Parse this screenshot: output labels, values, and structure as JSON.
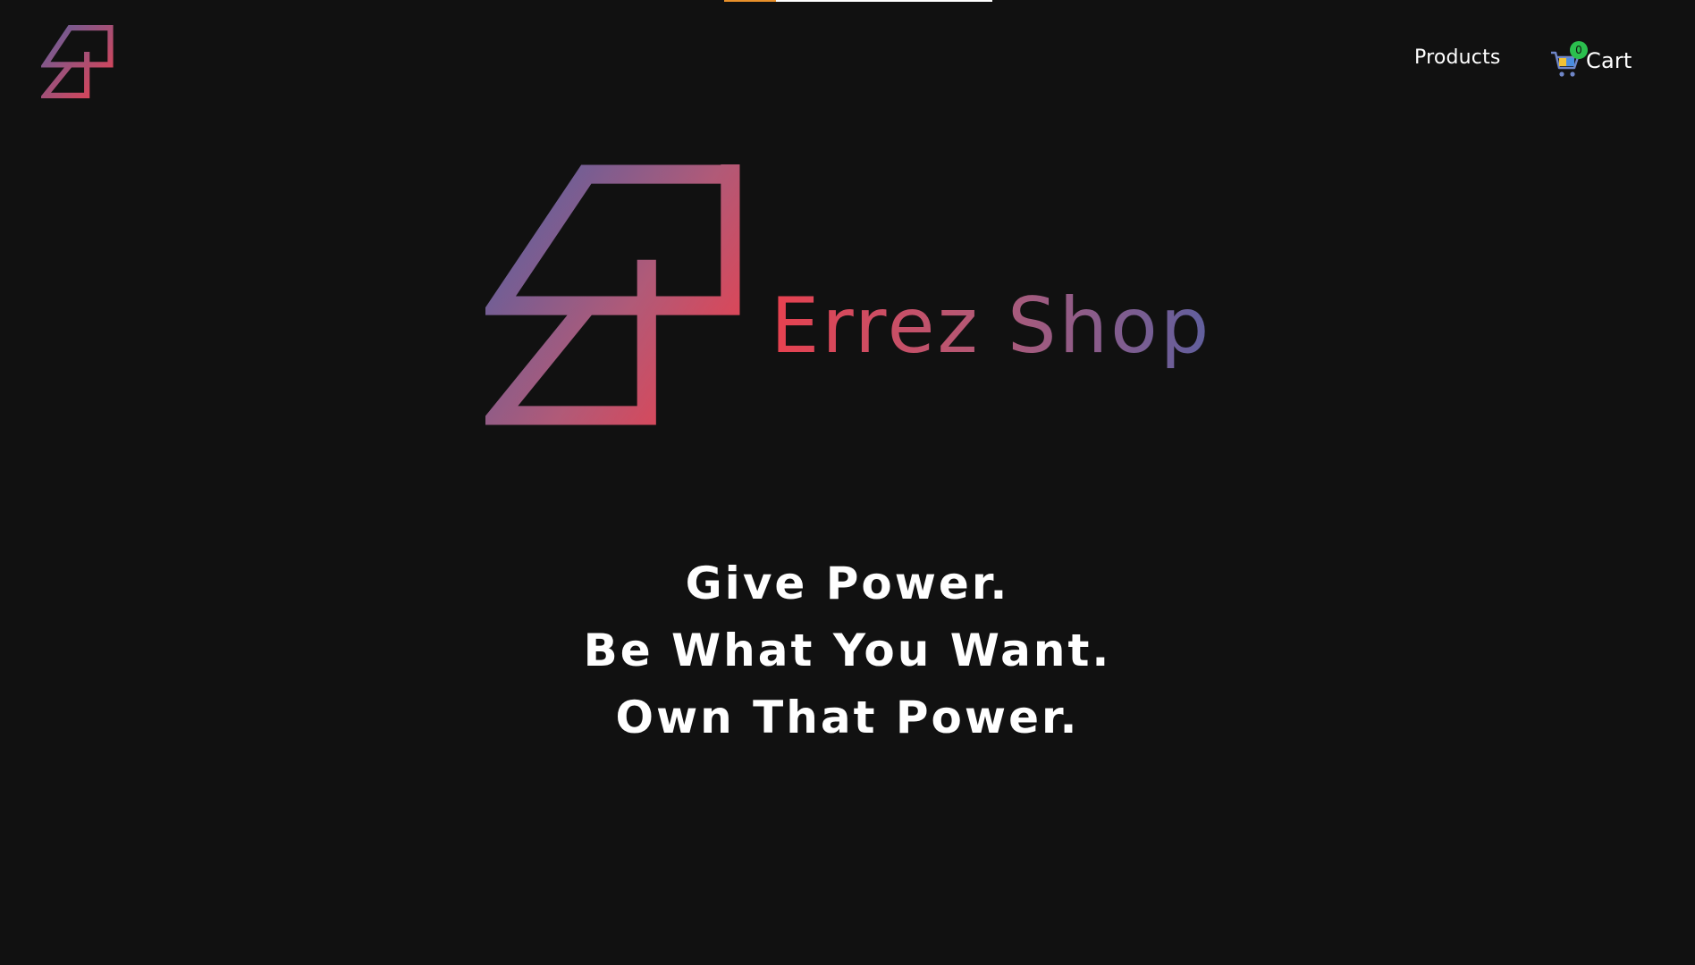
{
  "nav": {
    "logo_icon": "errez-logo-icon",
    "products_label": "Products",
    "cart": {
      "icon": "shopping-cart-icon",
      "count": "0",
      "label": "Cart"
    }
  },
  "hero": {
    "logo_icon": "errez-logo-icon",
    "title": "Errez Shop",
    "tagline": [
      "Give Power.",
      "Be What You Want.",
      "Own That Power."
    ]
  },
  "colors": {
    "background": "#111111",
    "gradient_red": "#e8414f",
    "gradient_blue": "#5f5f9e",
    "badge_green": "#2bbf4e"
  }
}
